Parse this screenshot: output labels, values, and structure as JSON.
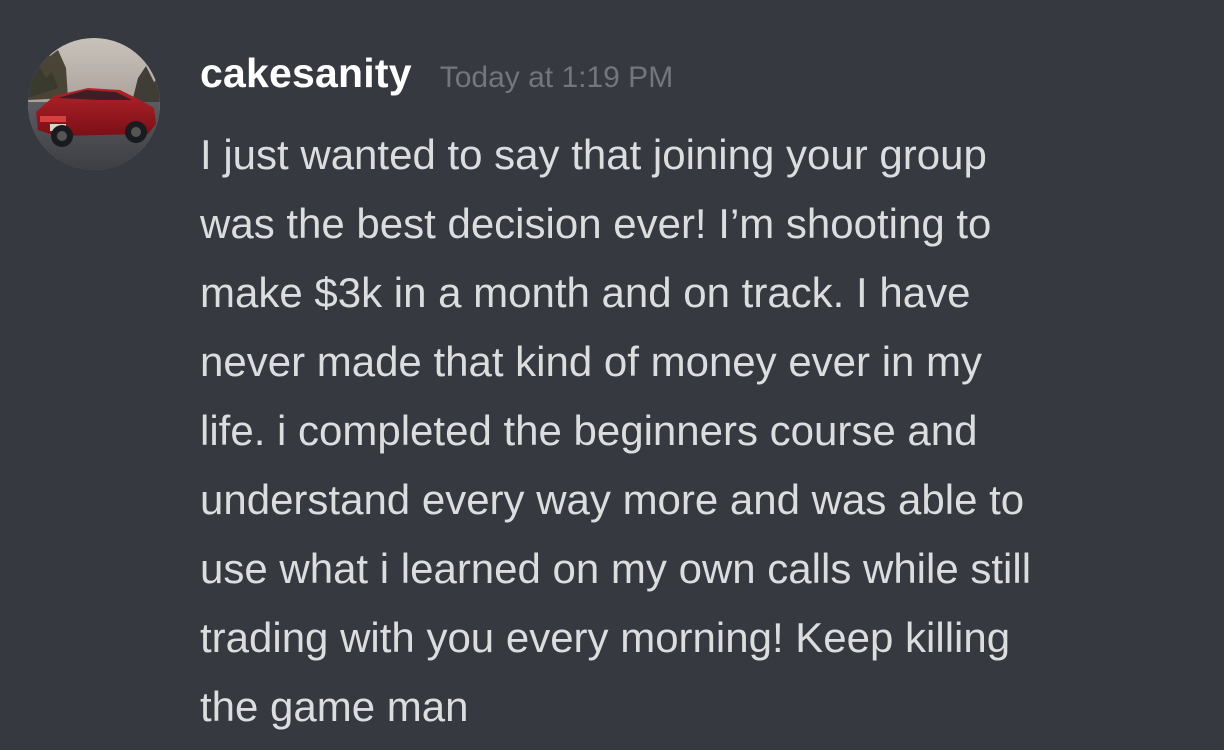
{
  "message": {
    "username": "cakesanity",
    "timestamp": "Today at 1:19 PM",
    "lines": [
      "I just wanted to say that joining your group",
      "was the best decision ever! I’m shooting to",
      "make $3k in a month and on track. I have",
      "never made that kind of money ever in my",
      "life. i completed the beginners course and",
      "understand every way more and was able to",
      "use what i learned on my own calls while still",
      "trading with you every morning! Keep killing",
      "the game man"
    ],
    "avatar_icon": "avatar-red-car-photo"
  },
  "colors": {
    "background": "#36393f",
    "username": "#ffffff",
    "timestamp": "#72767d",
    "message_text": "#dcddde"
  }
}
